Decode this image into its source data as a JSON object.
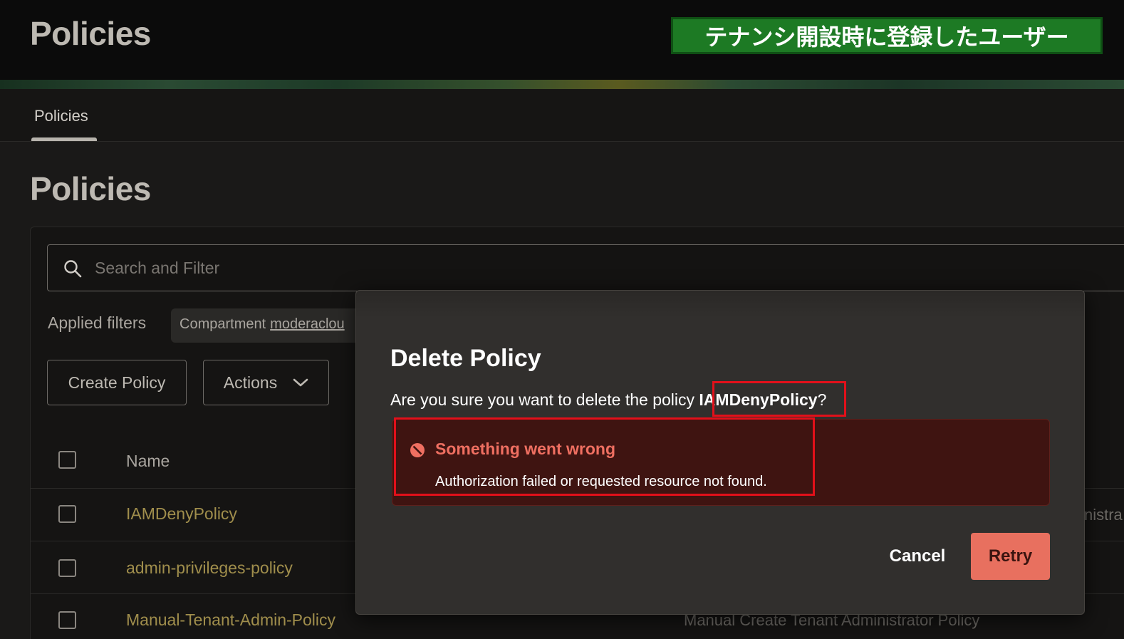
{
  "header": {
    "title": "Policies",
    "callout": "テナンシ開設時に登録したユーザー"
  },
  "tabs": [
    {
      "label": "Policies",
      "active": true
    }
  ],
  "page": {
    "title": "Policies"
  },
  "search": {
    "placeholder": "Search and Filter",
    "value": ""
  },
  "filters": {
    "label": "Applied filters",
    "chip": {
      "key": "Compartment",
      "value": "moderaclou"
    }
  },
  "toolbar": {
    "create_label": "Create Policy",
    "actions_label": "Actions"
  },
  "table": {
    "columns": [
      "Name"
    ],
    "rows": [
      {
        "name": "IAMDenyPolicy",
        "description_fragment": "nistra"
      },
      {
        "name": "admin-privileges-policy",
        "description_fragment": ""
      },
      {
        "name": "Manual-Tenant-Admin-Policy",
        "description_fragment": "Manual Create Tenant Administrator Policy"
      }
    ]
  },
  "modal": {
    "title": "Delete Policy",
    "question_prefix": "Are you sure you want to delete the policy ",
    "policy_name": "IAMDenyPolicy",
    "question_suffix": "?",
    "error": {
      "title": "Something went wrong",
      "message": "Authorization failed or requested resource not found."
    },
    "cancel_label": "Cancel",
    "retry_label": "Retry"
  },
  "colors": {
    "background": "#1a1918",
    "callout_green": "#1d7a24",
    "link_gold": "#a08e4c",
    "error_bg": "#3f1411",
    "error_text": "#ef6f61",
    "retry_button": "#e8705f",
    "highlight_red": "#e2101a"
  },
  "icons": {
    "search": "search-icon",
    "chevron": "chevron-down-icon",
    "error": "error-circle-icon"
  }
}
